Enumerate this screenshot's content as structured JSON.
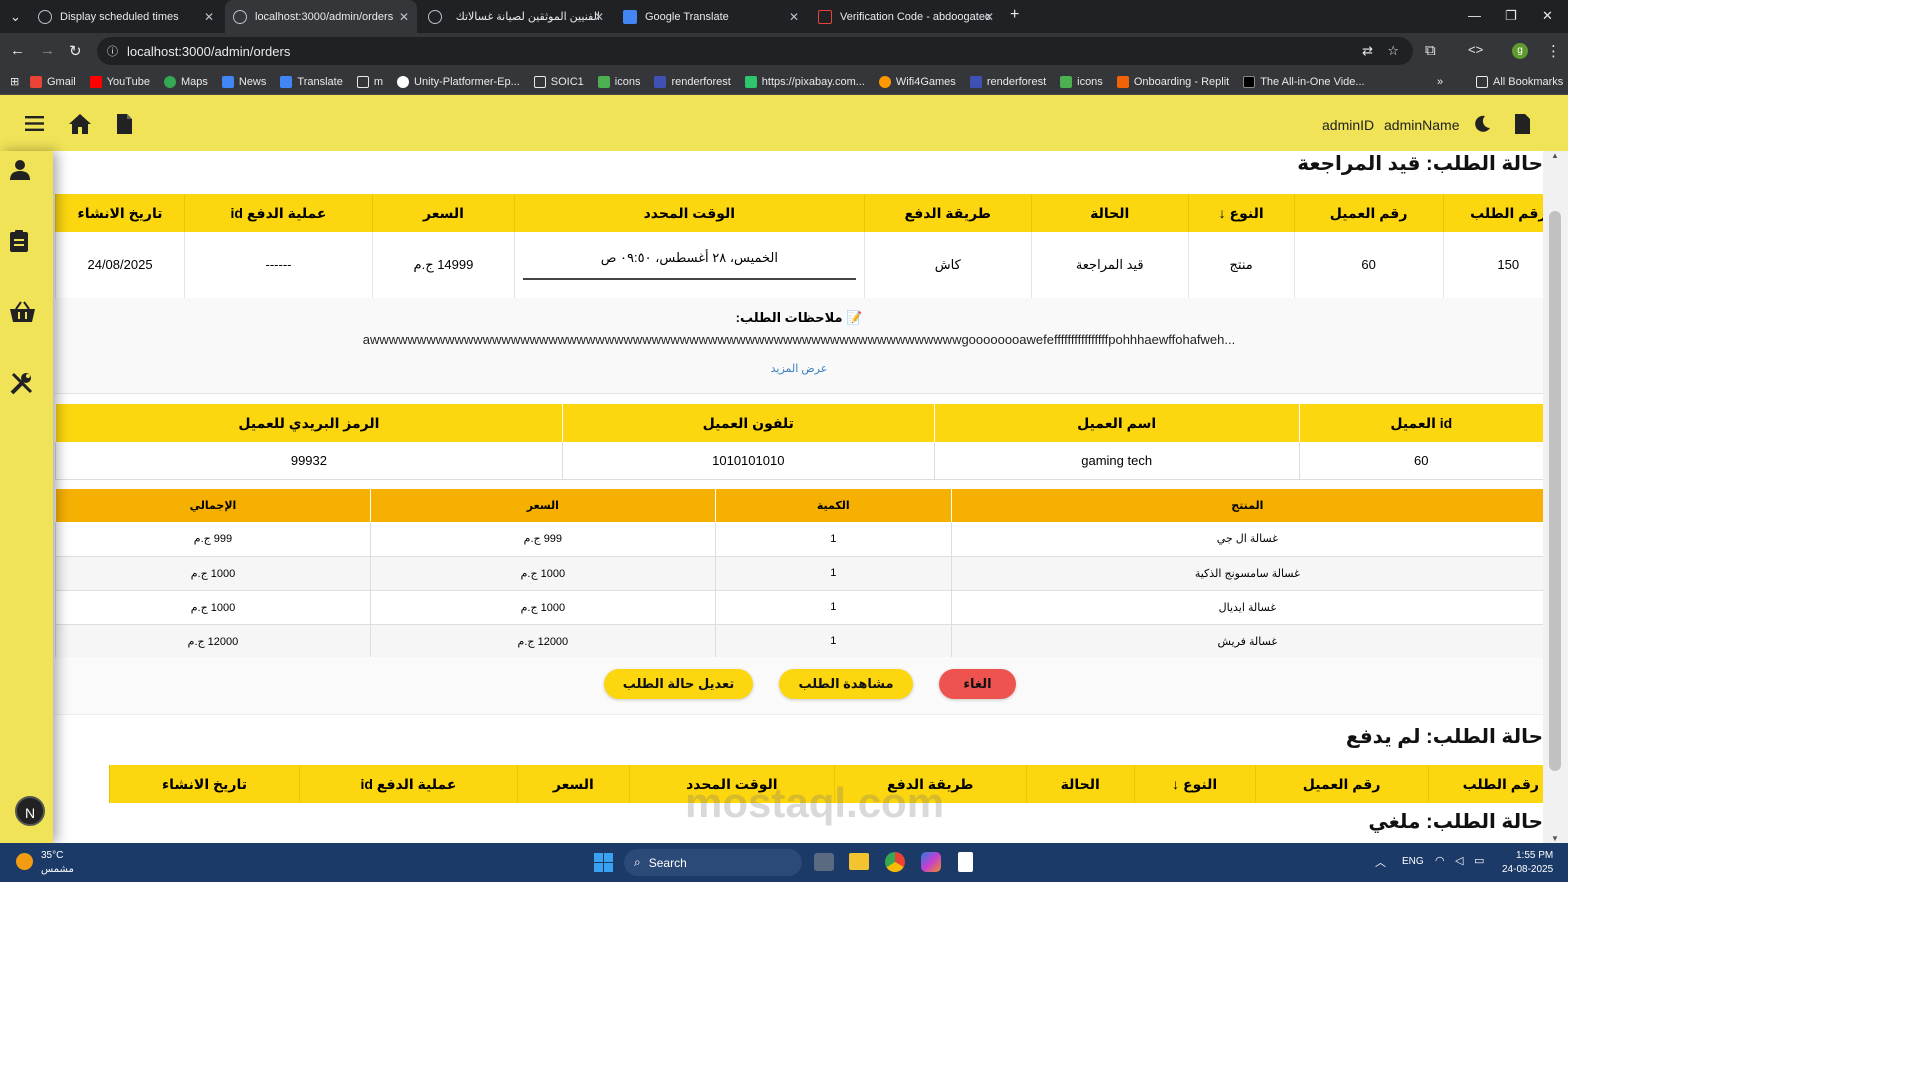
{
  "browser": {
    "tabs": [
      {
        "title": "Display scheduled times"
      },
      {
        "title": "localhost:3000/admin/orders"
      },
      {
        "title": "الفنيين الموثقين لصيانة غسالاتك"
      },
      {
        "title": "Google Translate"
      },
      {
        "title": "Verification Code - abdoogatec"
      }
    ],
    "url": "localhost:3000/admin/orders",
    "bookmarks": [
      "Gmail",
      "YouTube",
      "Maps",
      "News",
      "Translate",
      "m",
      "Unity-Platformer-Ep...",
      "SOIC1",
      "icons",
      "renderforest",
      "https://pixabay.com...",
      "Wifi4Games",
      "renderforest",
      "icons",
      "Onboarding - Replit",
      "The All-in-One Vide..."
    ],
    "all_bookmarks": "All Bookmarks",
    "profile_letter": "g"
  },
  "header": {
    "admin_id": "adminID",
    "admin_name": "adminName"
  },
  "section1": {
    "title": "حالة الطلب: قيد المراجعة",
    "order_headers": [
      "رقم الطلب",
      "رقم العميل",
      "النوع ↓",
      "الحالة",
      "طريقة الدفع",
      "الوقت المحدد",
      "السعر",
      "عملية الدفع id",
      "تاريخ الانشاء"
    ],
    "order_row": [
      "150",
      "60",
      "منتج",
      "قيد المراجعة",
      "كاش",
      "الخميس، ٢٨ أغسطس، ٠٩:٥٠ ص",
      "14999 ج.م",
      "------",
      "24/08/2025"
    ],
    "notes_label": "📝 ملاحظات الطلب:",
    "notes_text": "awwwwwwwwwwwwwwwwwwwwwwwwwwwwwwwwwwwwwwwwwwwwwwwwwwwwwwwwwwwwwwwgoooooooawefeffffffffffffffffpohhhaewffohafweh...",
    "show_more": "عرض المزيد",
    "customer_headers": [
      "id العميل",
      "اسم العميل",
      "تلفون العميل",
      "الرمز البريدي للعميل"
    ],
    "customer_row": [
      "60",
      "gaming tech",
      "1010101010",
      "99932"
    ],
    "product_headers": [
      "المنتج",
      "الكمية",
      "السعر",
      "الإجمالي"
    ],
    "products": [
      [
        "غسالة ال جي",
        "1",
        "999 ج.م",
        "999 ج.م"
      ],
      [
        "غسالة سامسونج الذكية",
        "1",
        "1000 ج.م",
        "1000 ج.م"
      ],
      [
        "غسالة ايديال",
        "1",
        "1000 ج.م",
        "1000 ج.م"
      ],
      [
        "غسالة فريش",
        "1",
        "12000 ج.م",
        "12000 ج.م"
      ]
    ],
    "buttons": {
      "cancel": "الغاء",
      "view": "مشاهدة الطلب",
      "edit": "تعديل حالة الطلب"
    }
  },
  "section2": {
    "title": "حالة الطلب: لم يدفع",
    "headers": [
      "رقم الطلب",
      "رقم العميل",
      "النوع ↓",
      "الحالة",
      "طريقة الدفع",
      "الوقت المحدد",
      "السعر",
      "عملية الدفع id",
      "تاريخ الانشاء"
    ]
  },
  "section3": {
    "title": "حالة الطلب: ملغي"
  },
  "floating_badge": "N",
  "watermark": "mostaql.com",
  "taskbar": {
    "weather_temp": "35°C",
    "weather_desc": "مشمس",
    "search_placeholder": "Search",
    "lang": "ENG",
    "time": "1:55 PM",
    "date": "24-08-2025"
  },
  "colors": {
    "yellow_header": "#fcd60e",
    "topbar": "#f0e358",
    "product_header": "#f6b002",
    "cancel_button": "#ef5350"
  }
}
